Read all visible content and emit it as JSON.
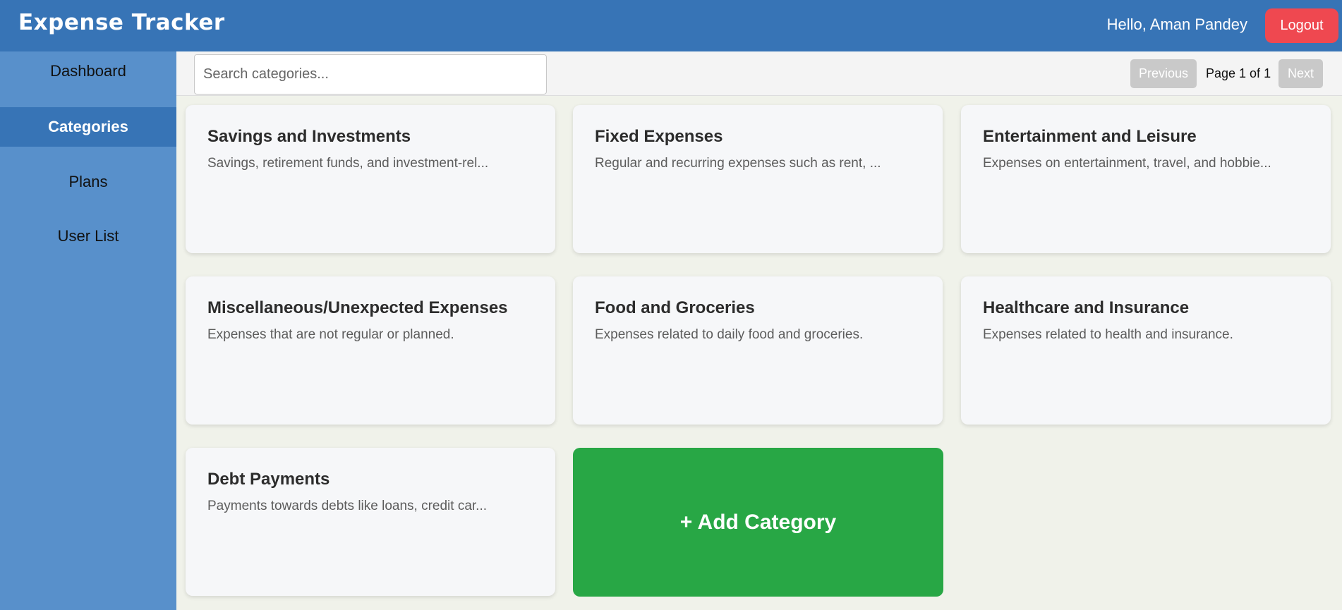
{
  "header": {
    "title": "Expense Tracker",
    "greeting": "Hello, Aman Pandey",
    "logout_label": "Logout"
  },
  "sidebar": {
    "items": [
      {
        "label": "Dashboard",
        "active": false
      },
      {
        "label": "Categories",
        "active": true
      },
      {
        "label": "Plans",
        "active": false
      },
      {
        "label": "User List",
        "active": false
      }
    ]
  },
  "toolbar": {
    "search_placeholder": "Search categories...",
    "previous_label": "Previous",
    "page_info": "Page 1 of 1",
    "next_label": "Next"
  },
  "categories": [
    {
      "title": "Savings and Investments",
      "description": "Savings, retirement funds, and investment-rel..."
    },
    {
      "title": "Fixed Expenses",
      "description": "Regular and recurring expenses such as rent, ..."
    },
    {
      "title": "Entertainment and Leisure",
      "description": "Expenses on entertainment, travel, and hobbie..."
    },
    {
      "title": "Miscellaneous/Unexpected Expenses",
      "description": "Expenses that are not regular or planned."
    },
    {
      "title": "Food and Groceries",
      "description": "Expenses related to daily food and groceries."
    },
    {
      "title": "Healthcare and Insurance",
      "description": "Expenses related to health and insurance."
    },
    {
      "title": "Debt Payments",
      "description": "Payments towards debts like loans, credit car..."
    }
  ],
  "add_category_label": "+ Add Category",
  "colors": {
    "header": "#3774b6",
    "sidebar": "#5890cb",
    "logout": "#ef4850",
    "add_category": "#28a745"
  }
}
